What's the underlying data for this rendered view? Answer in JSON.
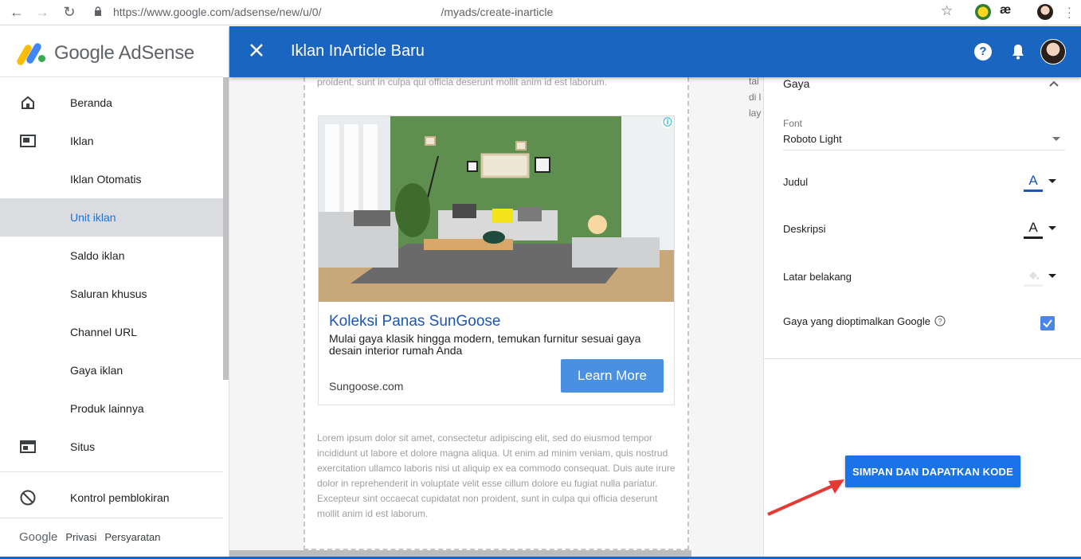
{
  "browser": {
    "url_prefix": "https://www.google.com/adsense/new/u/0/",
    "url_host": "www.google.com",
    "url_suffix": "/myads/create-inarticle",
    "ext_label": "æ"
  },
  "sidebar": {
    "brand": "Google AdSense",
    "items": [
      {
        "label": "Beranda",
        "icon": "home-icon"
      },
      {
        "label": "Iklan",
        "icon": "ads-icon"
      },
      {
        "label": "Iklan Otomatis"
      },
      {
        "label": "Unit iklan",
        "active": true
      },
      {
        "label": "Saldo iklan"
      },
      {
        "label": "Saluran khusus"
      },
      {
        "label": "Channel URL"
      },
      {
        "label": "Gaya iklan"
      },
      {
        "label": "Produk lainnya"
      },
      {
        "label": "Situs",
        "icon": "sites-icon"
      },
      {
        "label": "Kontrol pemblokiran",
        "icon": "block-icon"
      }
    ],
    "footer": {
      "google": "Google",
      "privacy": "Privasi",
      "terms": "Persyaratan"
    }
  },
  "header": {
    "title": "Iklan InArticle Baru",
    "help": "?"
  },
  "preview": {
    "lorem_top": "proident, sunt in culpa qui officia deserunt mollit anim id est laborum.",
    "lorem_bottom": "Lorem ipsum dolor sit amet, consectetur adipiscing elit, sed do eiusmod tempor incididunt ut labore et dolore magna aliqua. Ut enim ad minim veniam, quis nostrud exercitation ullamco laboris nisi ut aliquip ex ea commodo consequat. Duis aute irure dolor in reprehenderit in voluptate velit esse cillum dolore eu fugiat nulla pariatur. Excepteur sint occaecat cupidatat non proident, sunt in culpa qui officia deserunt mollit anim id est laborum.",
    "side_snippet": [
      "tai",
      "di l",
      "lay"
    ],
    "ad": {
      "info": "ⓘ",
      "title": "Koleksi Panas SunGoose",
      "description": "Mulai gaya klasik hingga modern, temukan furnitur sesuai gaya desain interior rumah Anda",
      "url": "Sungoose.com",
      "cta": "Learn More"
    }
  },
  "settings": {
    "section": "Gaya",
    "font_label": "Font",
    "font_value": "Roboto Light",
    "judul": {
      "label": "Judul",
      "color": "#1a55b8"
    },
    "deskripsi": {
      "label": "Deskripsi",
      "color": "#202124"
    },
    "latar": {
      "label": "Latar belakang",
      "color": "#ffffff"
    },
    "optimized": {
      "label": "Gaya yang dioptimalkan Google",
      "checked": true
    },
    "save_button": "SIMPAN DAN DAPATKAN KODE"
  },
  "colors": {
    "header_blue": "#1a65c0",
    "accent": "#1a73e8",
    "arrow": "#e53935"
  }
}
